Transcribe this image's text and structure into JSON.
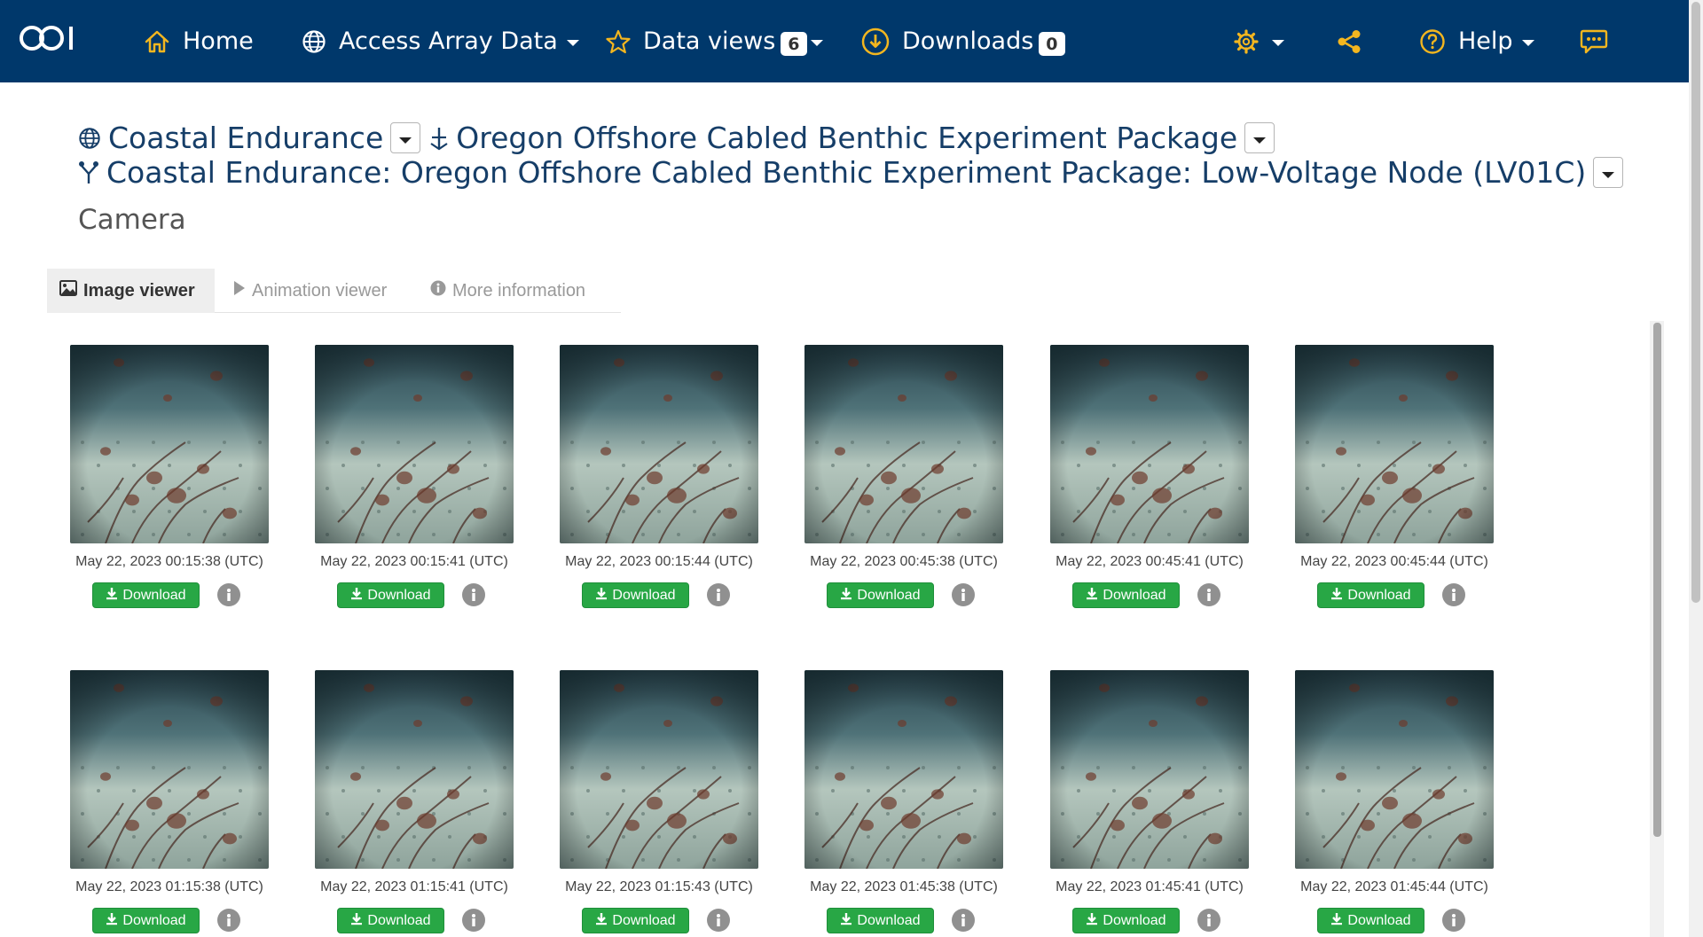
{
  "nav": {
    "logo_text": "OOI",
    "home_label": "Home",
    "access_label": "Access Array Data",
    "dataviews_label": "Data views",
    "dataviews_count": "6",
    "downloads_label": "Downloads",
    "downloads_count": "0",
    "help_label": "Help",
    "icons": [
      "home-icon",
      "globe-icon",
      "star-icon",
      "download-circle-icon",
      "gear-icon",
      "share-icon",
      "question-circle-icon",
      "chat-icon"
    ],
    "accent_color": "#f3b61f",
    "background_color": "#00386b"
  },
  "breadcrumb": {
    "array": "Coastal Endurance",
    "site": "Oregon Offshore Cabled Benthic Experiment Package",
    "node": "Coastal Endurance: Oregon Offshore Cabled Benthic Experiment Package: Low-Voltage Node (LV01C)"
  },
  "instrument_title": "Camera",
  "tabs": {
    "image_viewer": "Image viewer",
    "animation_viewer": "Animation viewer",
    "more_info": "More information"
  },
  "download_label": "Download",
  "download_color": "#28a745",
  "images": [
    {
      "timestamp": "May 22, 2023 00:15:38 (UTC)"
    },
    {
      "timestamp": "May 22, 2023 00:15:41 (UTC)"
    },
    {
      "timestamp": "May 22, 2023 00:15:44 (UTC)"
    },
    {
      "timestamp": "May 22, 2023 00:45:38 (UTC)"
    },
    {
      "timestamp": "May 22, 2023 00:45:41 (UTC)"
    },
    {
      "timestamp": "May 22, 2023 00:45:44 (UTC)"
    },
    {
      "timestamp": "May 22, 2023 01:15:38 (UTC)"
    },
    {
      "timestamp": "May 22, 2023 01:15:41 (UTC)"
    },
    {
      "timestamp": "May 22, 2023 01:15:43 (UTC)"
    },
    {
      "timestamp": "May 22, 2023 01:45:38 (UTC)"
    },
    {
      "timestamp": "May 22, 2023 01:45:41 (UTC)"
    },
    {
      "timestamp": "May 22, 2023 01:45:44 (UTC)"
    }
  ]
}
